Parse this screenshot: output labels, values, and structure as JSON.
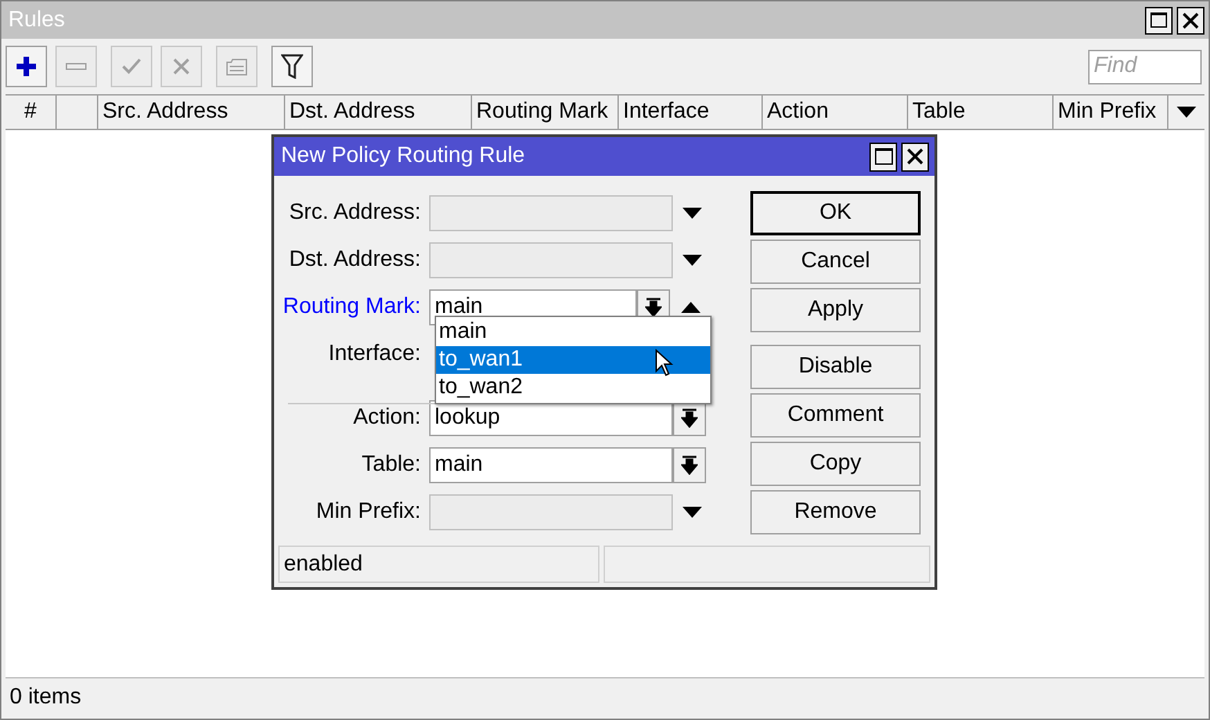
{
  "window": {
    "title": "Rules"
  },
  "toolbar": [
    {
      "kind": "add",
      "disabled": false
    },
    {
      "kind": "remove",
      "disabled": true
    },
    {
      "kind": "enable",
      "disabled": true
    },
    {
      "kind": "disable",
      "disabled": true
    },
    {
      "kind": "comment",
      "disabled": true
    },
    {
      "kind": "filter",
      "disabled": false
    }
  ],
  "search": {
    "placeholder": "Find"
  },
  "table": {
    "columns": [
      "#",
      null,
      "Src. Address",
      "Dst. Address",
      "Routing Mark",
      "Interface",
      "Action",
      "Table",
      "Min Prefix"
    ]
  },
  "status_bar": "0 items",
  "dialog": {
    "title": "New Policy Routing Rule",
    "fields": [
      {
        "label": "Src. Address:",
        "kind": "empty",
        "modified": false
      },
      {
        "label": "Dst. Address:",
        "kind": "empty",
        "modified": false
      },
      {
        "label": "Routing Mark:",
        "kind": "select",
        "value": "main",
        "modified": true,
        "open": true
      },
      {
        "label": "Interface:",
        "kind": "covered",
        "modified": false
      },
      {
        "label": "Action:",
        "kind": "select",
        "value": "lookup",
        "modified": false
      },
      {
        "label": "Table:",
        "kind": "select",
        "value": "main",
        "modified": false
      },
      {
        "label": "Min Prefix:",
        "kind": "empty",
        "modified": false
      }
    ],
    "dropdown": [
      {
        "label": "main",
        "selected": false
      },
      {
        "label": "to_wan1",
        "selected": true
      },
      {
        "label": "to_wan2",
        "selected": false
      }
    ],
    "buttons": [
      "OK",
      "Cancel",
      "Apply",
      "Disable",
      "Comment",
      "Copy",
      "Remove"
    ],
    "status": "enabled"
  }
}
